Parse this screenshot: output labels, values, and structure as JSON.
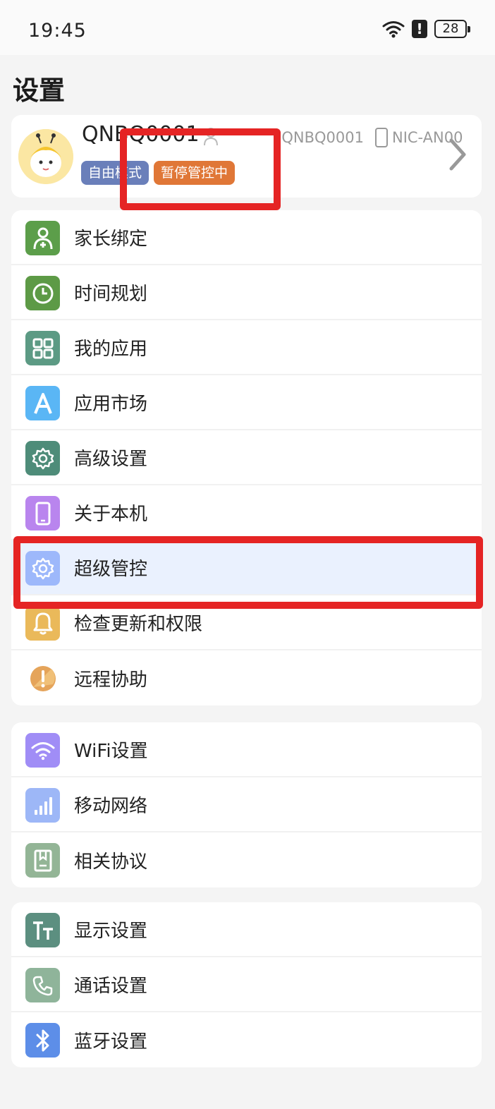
{
  "status_bar": {
    "time": "19:45",
    "alert": "!",
    "battery": "28"
  },
  "page_title": "设置",
  "profile": {
    "name": "QNBQ0001",
    "account": "1QNBQ0001",
    "device": "NIC-AN00",
    "badges": [
      "自由模式",
      "暂停管控中"
    ]
  },
  "groups": [
    {
      "items": [
        {
          "label": "家长绑定",
          "icon": "parent-bind-icon",
          "color": "#5c9e4a"
        },
        {
          "label": "时间规划",
          "icon": "clock-icon",
          "color": "#5d9a46"
        },
        {
          "label": "我的应用",
          "icon": "grid-icon",
          "color": "#5c9a84"
        },
        {
          "label": "应用市场",
          "icon": "app-store-icon",
          "color": "#5ab6f5"
        },
        {
          "label": "高级设置",
          "icon": "gear-icon",
          "color": "#4e8c79"
        },
        {
          "label": "关于本机",
          "icon": "phone-icon",
          "color": "#b985ee"
        },
        {
          "label": "超级管控",
          "icon": "gear-icon",
          "color": "#9db8fb",
          "active": true
        },
        {
          "label": "检查更新和权限",
          "icon": "bell-icon",
          "color": "#eab95a"
        },
        {
          "label": "远程协助",
          "icon": "alert-circle-icon",
          "color": "#e5a45a"
        }
      ]
    },
    {
      "items": [
        {
          "label": "WiFi设置",
          "icon": "wifi-icon",
          "color": "#a08df6"
        },
        {
          "label": "移动网络",
          "icon": "signal-icon",
          "color": "#9db7f7"
        },
        {
          "label": "相关协议",
          "icon": "document-icon",
          "color": "#93b596"
        }
      ]
    },
    {
      "items": [
        {
          "label": "显示设置",
          "icon": "text-size-icon",
          "color": "#5c8f80"
        },
        {
          "label": "通话设置",
          "icon": "call-icon",
          "color": "#8fb49a"
        },
        {
          "label": "蓝牙设置",
          "icon": "bluetooth-icon",
          "color": "#5d8ee8"
        }
      ]
    }
  ],
  "highlight_color": "#e52424"
}
